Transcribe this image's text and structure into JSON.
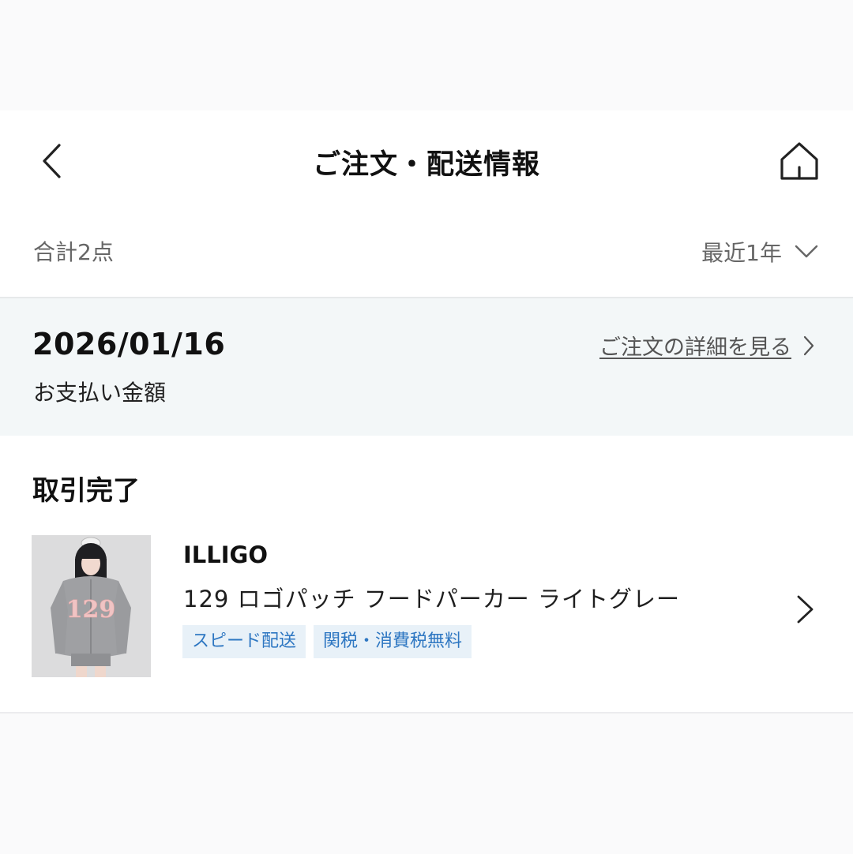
{
  "header": {
    "title": "ご注文・配送情報",
    "back_icon": "chevron-left-icon",
    "home_icon": "home-icon"
  },
  "summary": {
    "total_count": "合計2点",
    "period": "最近1年"
  },
  "order": {
    "date": "2026/01/16",
    "detail_link": "ご注文の詳細を見る",
    "payment_label": "お支払い金額"
  },
  "status": {
    "label": "取引完了"
  },
  "item": {
    "brand": "ILLIGO",
    "name": "129 ロゴパッチ フードパーカー ライトグレー",
    "tags": [
      "スピード配送",
      "関税・消費税無料"
    ],
    "thumbnail_text": "129"
  },
  "colors": {
    "tag_text": "#2e77c2",
    "tag_background": "#e8f1f8",
    "band_background": "#f3f7f8"
  }
}
